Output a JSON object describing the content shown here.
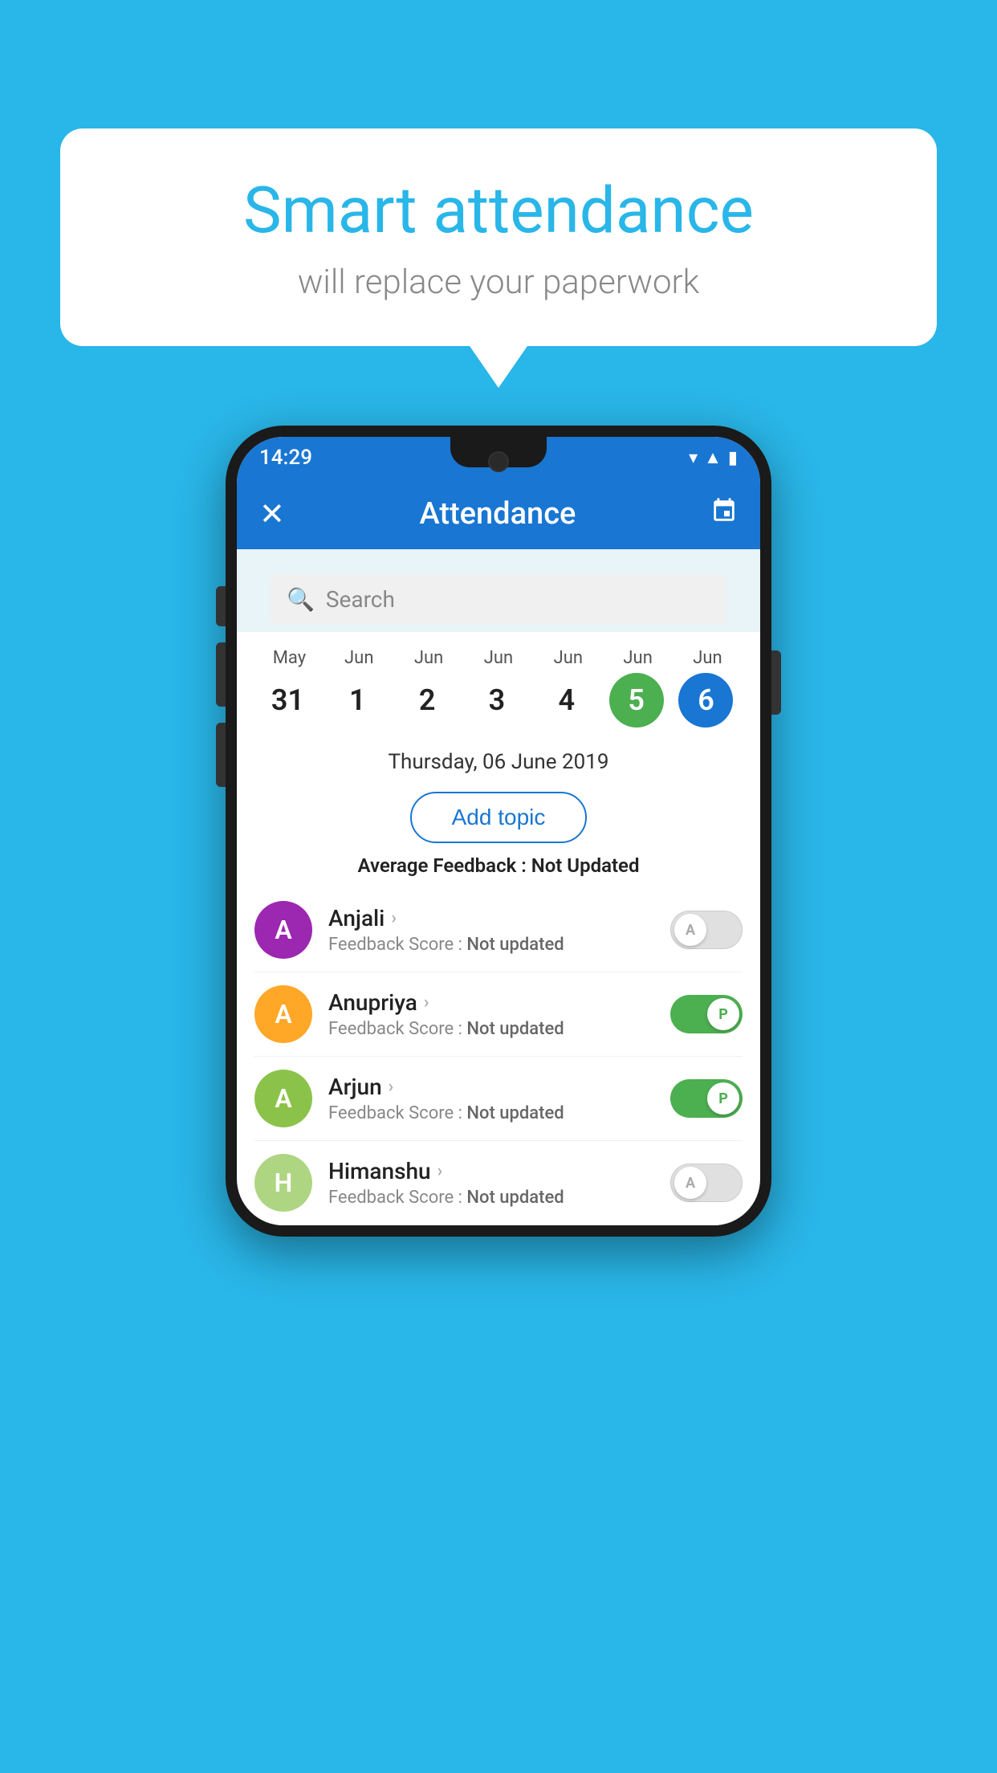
{
  "background_color": "#29b6e8",
  "speech_bubble": {
    "title": "Smart attendance",
    "subtitle": "will replace your paperwork"
  },
  "status_bar": {
    "time": "14:29",
    "icons": [
      "wifi",
      "signal",
      "battery"
    ]
  },
  "app_bar": {
    "close_label": "✕",
    "title": "Attendance",
    "calendar_icon": "📅"
  },
  "search": {
    "placeholder": "Search"
  },
  "dates": [
    {
      "month": "May",
      "day": "31",
      "state": "normal"
    },
    {
      "month": "Jun",
      "day": "1",
      "state": "normal"
    },
    {
      "month": "Jun",
      "day": "2",
      "state": "normal"
    },
    {
      "month": "Jun",
      "day": "3",
      "state": "normal"
    },
    {
      "month": "Jun",
      "day": "4",
      "state": "normal"
    },
    {
      "month": "Jun",
      "day": "5",
      "state": "today"
    },
    {
      "month": "Jun",
      "day": "6",
      "state": "selected"
    }
  ],
  "selected_date": {
    "display": "Thursday, 06 June 2019"
  },
  "add_topic_label": "Add topic",
  "average_feedback": {
    "label": "Average Feedback : ",
    "value": "Not Updated"
  },
  "students": [
    {
      "name": "Anjali",
      "avatar_letter": "A",
      "avatar_color": "#9c27b0",
      "feedback_label": "Feedback Score : ",
      "feedback_value": "Not updated",
      "attendance": "absent",
      "toggle_letter": "A"
    },
    {
      "name": "Anupriya",
      "avatar_letter": "A",
      "avatar_color": "#ffa726",
      "feedback_label": "Feedback Score : ",
      "feedback_value": "Not updated",
      "attendance": "present",
      "toggle_letter": "P"
    },
    {
      "name": "Arjun",
      "avatar_letter": "A",
      "avatar_color": "#8bc34a",
      "feedback_label": "Feedback Score : ",
      "feedback_value": "Not updated",
      "attendance": "present",
      "toggle_letter": "P"
    },
    {
      "name": "Himanshu",
      "avatar_letter": "H",
      "avatar_color": "#aed581",
      "feedback_label": "Feedback Score : ",
      "feedback_value": "Not updated",
      "attendance": "absent",
      "toggle_letter": "A"
    }
  ]
}
